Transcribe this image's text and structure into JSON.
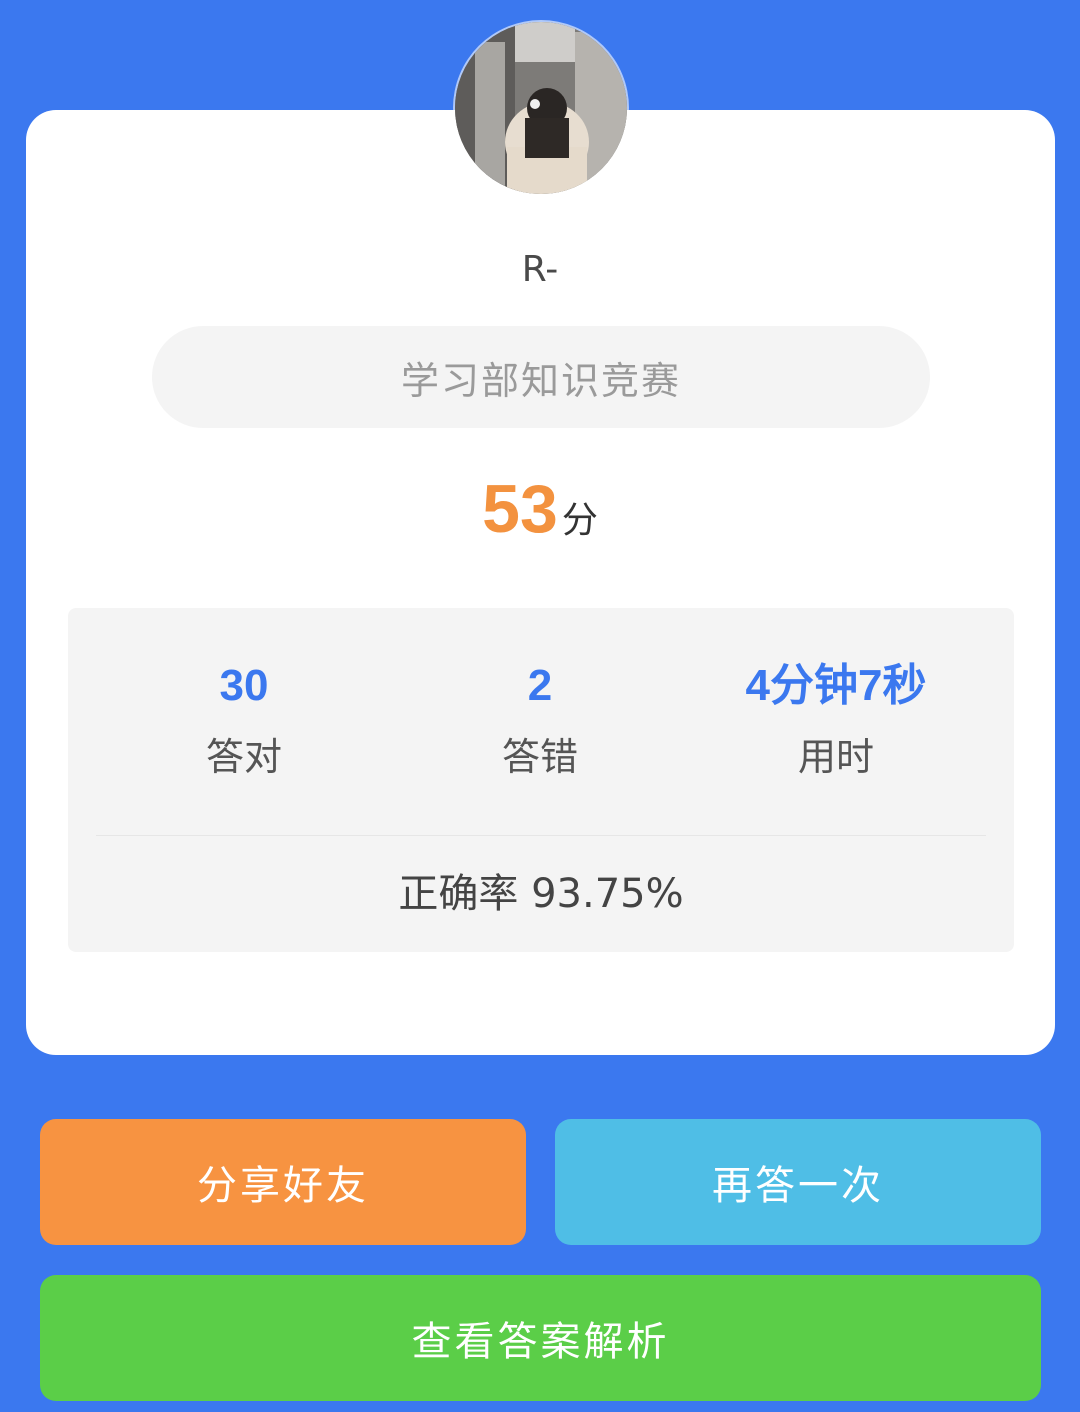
{
  "user": {
    "name": "R-",
    "avatar": "user-avatar-photo"
  },
  "quiz": {
    "title": "学习部知识竞赛"
  },
  "score": {
    "value": "53",
    "unit": "分"
  },
  "stats": {
    "correct": {
      "value": "30",
      "label": "答对"
    },
    "wrong": {
      "value": "2",
      "label": "答错"
    },
    "time": {
      "value": "4分钟7秒",
      "label": "用时"
    },
    "accuracy": "正确率 93.75%"
  },
  "buttons": {
    "share": "分享好友",
    "retry": "再答一次",
    "analysis": "查看答案解析"
  },
  "colors": {
    "background": "#3b78ef",
    "score": "#f3923f",
    "stat_value": "#3b78ef",
    "share_button": "#f79341",
    "retry_button": "#4fbee6",
    "analysis_button": "#5bce48"
  }
}
